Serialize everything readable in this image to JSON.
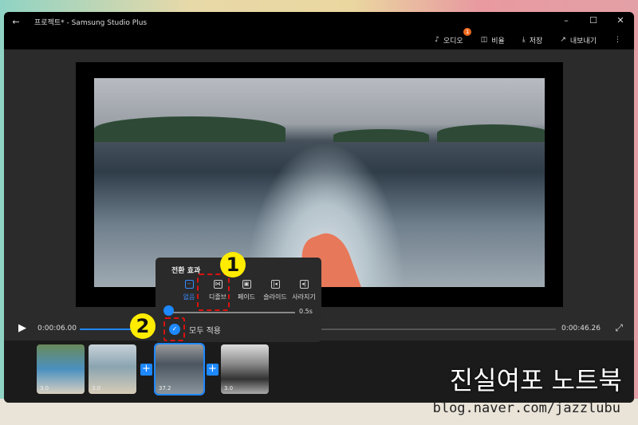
{
  "window": {
    "title": "프로젝트* - Samsung Studio Plus",
    "back_icon": "←",
    "minimize": "–",
    "maximize": "☐",
    "close": "✕"
  },
  "toolbar": {
    "audio": "오디오",
    "audio_badge": "1",
    "ratio": "비율",
    "save": "저장",
    "export": "내보내기",
    "more": "⋮"
  },
  "player": {
    "current_time": "0:00:06.00",
    "total_time": "0:00:46.26",
    "progress": 0.13
  },
  "transition_popup": {
    "title": "전환 효과",
    "options": [
      {
        "label": "없음",
        "icon": "−",
        "active": true
      },
      {
        "label": "디졸브",
        "icon": "⋈"
      },
      {
        "label": "페이드",
        "icon": "▣"
      },
      {
        "label": "슬라이드",
        "icon": "|◂"
      },
      {
        "label": "사라지기",
        "icon": "◂|"
      }
    ],
    "duration": "0.5s",
    "apply_all": "모두 적용"
  },
  "annotations": {
    "one": "1",
    "two": "2"
  },
  "timeline": {
    "clips": [
      {
        "duration": "3.0"
      },
      {
        "duration": "3.0"
      },
      {
        "duration": "37.2"
      },
      {
        "duration": "3.0"
      }
    ],
    "add": "+"
  },
  "watermark": {
    "title": "진실여포 노트북",
    "url": "blog.naver.com/jazzlubu"
  }
}
